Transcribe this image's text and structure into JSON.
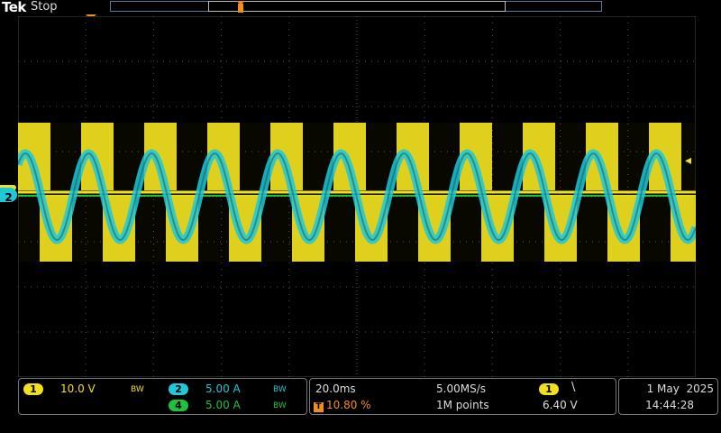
{
  "header": {
    "brand": "Tek",
    "acq_state": "Stop"
  },
  "markers": {
    "trigger_marker": "T",
    "ch2_ground": "2",
    "trigger_level_arrow": "◂"
  },
  "channels": [
    {
      "id": "1",
      "scale": "10.0 V",
      "bw": "BW",
      "color": "#f0e020"
    },
    {
      "id": "2",
      "scale": "5.00 A",
      "bw": "BW",
      "color": "#20c8d8"
    },
    {
      "id": "4",
      "scale": "5.00 A",
      "bw": "BW",
      "color": "#20c040"
    }
  ],
  "timebase": {
    "scale": "20.0ms",
    "sample_rate": "5.00MS/s",
    "trigger_pos_icon": "T",
    "trigger_pos": "10.80 %",
    "record_length": "1M points"
  },
  "trigger": {
    "source": "1",
    "slope": "\\",
    "level": "6.40 V"
  },
  "datetime": {
    "date": "1 May  2025",
    "time": "14:44:28"
  },
  "colors": {
    "ch1": "#f0e020",
    "ch2": "#20c8d8",
    "ch4": "#20c040",
    "trigger": "#f08c20",
    "grid": "#555555"
  }
}
